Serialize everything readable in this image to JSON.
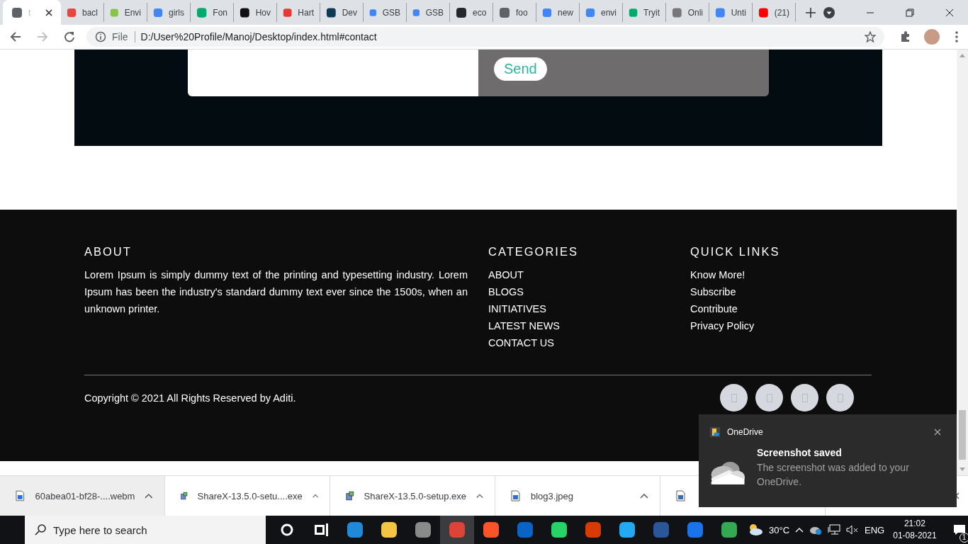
{
  "browser": {
    "tabs": [
      {
        "title": "t",
        "selected": true,
        "color": "#5f6368"
      },
      {
        "title": "bacl",
        "selected": false,
        "color": "#e8453c"
      },
      {
        "title": "Envi",
        "selected": false,
        "color": "#8bc34a"
      },
      {
        "title": "girls",
        "selected": false,
        "color": "#4285f4"
      },
      {
        "title": "Fon",
        "selected": false,
        "color": "#04aa6d"
      },
      {
        "title": "Hov",
        "selected": false,
        "color": "#111111"
      },
      {
        "title": "Hart",
        "selected": false,
        "color": "#e53935"
      },
      {
        "title": "Dev",
        "selected": false,
        "color": "#0d3a57"
      },
      {
        "title": "GSB",
        "selected": false,
        "color": "#4285f4"
      },
      {
        "title": "GSB",
        "selected": false,
        "color": "#4285f4"
      },
      {
        "title": "eco",
        "selected": false,
        "color": "#24292e"
      },
      {
        "title": "foo",
        "selected": false,
        "color": "#5f6368"
      },
      {
        "title": "new",
        "selected": false,
        "color": "#4285f4"
      },
      {
        "title": "envi",
        "selected": false,
        "color": "#4285f4"
      },
      {
        "title": "Tryit",
        "selected": false,
        "color": "#04aa6d"
      },
      {
        "title": "Onli",
        "selected": false,
        "color": "#777777"
      },
      {
        "title": "Unti",
        "selected": false,
        "color": "#4285f4"
      },
      {
        "title": "(21)",
        "selected": false,
        "color": "#ff0000"
      }
    ],
    "address_bar": {
      "scheme": "File",
      "url": "D:/User%20Profile/Manoj/Desktop/index.html#contact"
    }
  },
  "page": {
    "contact_form": {
      "send_button": "Send"
    },
    "footer": {
      "columns": [
        {
          "kind": "text",
          "heading": "ABOUT",
          "text": "Lorem Ipsum is simply dummy text of the printing and typesetting industry. Lorem Ipsum has been the industry's standard dummy text ever since the 1500s, when an unknown printer."
        },
        {
          "kind": "links",
          "heading": "CATEGORIES",
          "links": [
            "ABOUT",
            "BLOGS",
            "INITIATIVES",
            "LATEST NEWS",
            "CONTACT US"
          ]
        },
        {
          "kind": "links",
          "heading": "QUICK LINKS",
          "links": [
            "Know More!",
            "Subscribe",
            "Contribute",
            "Privacy Policy"
          ]
        }
      ],
      "copyright": "Copyright © 2021 All Rights Reserved by Aditi.",
      "social_buttons": [
        {
          "kind": "missing-glyph"
        },
        {
          "kind": "missing-glyph"
        },
        {
          "kind": "missing-glyph"
        },
        {
          "kind": "missing-glyph"
        }
      ]
    }
  },
  "downloads": {
    "items": [
      {
        "name": "60abea01-bf28-....webm",
        "hovered": true,
        "kind": "video"
      },
      {
        "name": "ShareX-13.5.0-setu....exe",
        "hovered": false,
        "kind": "installer"
      },
      {
        "name": "ShareX-13.5.0-setup.exe",
        "hovered": false,
        "kind": "installer"
      },
      {
        "name": "blog3.jpeg",
        "hovered": false,
        "kind": "image"
      },
      {
        "hovered": false,
        "kind": "image"
      }
    ]
  },
  "notification": {
    "app": "OneDrive",
    "title": "Screenshot saved",
    "message": "The screenshot was added to your OneDrive."
  },
  "taskbar": {
    "search_placeholder": "Type here to search",
    "apps": [
      {
        "kind": "cortana",
        "selected": false,
        "color": "#ffffff"
      },
      {
        "kind": "taskview",
        "selected": false,
        "color": "#ffffff"
      },
      {
        "kind": "app",
        "selected": false,
        "color": "#1f8ad8"
      },
      {
        "kind": "app",
        "selected": false,
        "color": "#f4c542"
      },
      {
        "kind": "app",
        "selected": false,
        "color": "#8a8a8a"
      },
      {
        "kind": "app",
        "selected": true,
        "color": "#db4437"
      },
      {
        "kind": "app",
        "selected": false,
        "color": "#fb542b"
      },
      {
        "kind": "app",
        "selected": false,
        "color": "#0a64c6"
      },
      {
        "kind": "app",
        "selected": false,
        "color": "#25d366"
      },
      {
        "kind": "app",
        "selected": false,
        "color": "#d83b01"
      },
      {
        "kind": "app",
        "selected": false,
        "color": "#23a9f2"
      },
      {
        "kind": "app",
        "selected": false,
        "color": "#2b579a"
      },
      {
        "kind": "app",
        "selected": false,
        "color": "#1a73e8"
      },
      {
        "kind": "app",
        "selected": false,
        "color": "#34a853"
      }
    ],
    "tray": {
      "temperature": "30°C",
      "language": "ENG",
      "time": "21:02",
      "date": "01-08-2021",
      "notification_count": "1"
    }
  }
}
